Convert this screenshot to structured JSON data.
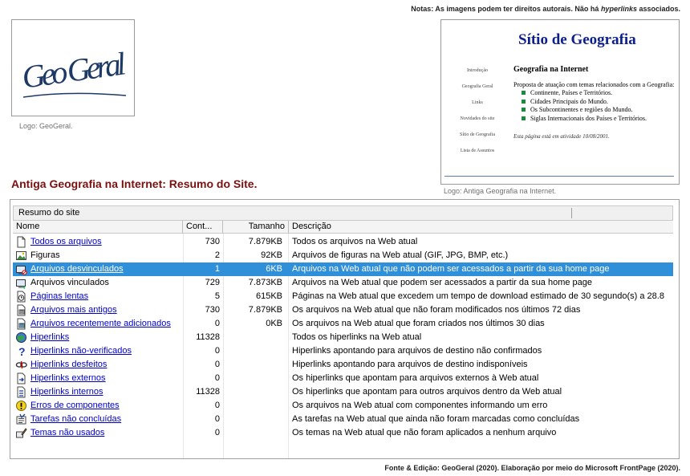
{
  "note": {
    "prefix": "Notas: As imagens podem ter direitos autorais. Não há ",
    "emphasis": "hyperlinks",
    "suffix": " associados."
  },
  "logo": {
    "text": "Geo Geral",
    "caption": "Logo: GeoGeral.",
    "color": "#1d3a66"
  },
  "screenshot": {
    "title": "Sítio de Geografia",
    "nav": [
      "Introdução",
      "Geografia Geral",
      "Links",
      "Novidades do site",
      "Sítio de Geografia",
      "Lista de Assuntos"
    ],
    "heading": "Geografia na Internet",
    "intro": "Proposta de atuação com temas relacionados com a Geografia:",
    "list": [
      "Continente, Países e Territórios.",
      "Cidades Principais do Mundo.",
      "Os Subcontinentes e regiões do Mundo.",
      "Siglas Internacionais dos Países e Territórios."
    ],
    "footer": "Esta página está em atividade 10/08/2001.",
    "caption": "Logo: Antiga Geografia na Internet."
  },
  "section_title": "Antiga Geografia na Internet: Resumo do Site.",
  "report": {
    "title": "Resumo do site",
    "columns": {
      "name": "Nome",
      "count": "Cont...",
      "size": "Tamanho",
      "desc": "Descrição"
    },
    "rows": [
      {
        "icon": "document-icon",
        "name": "Todos os arquivos",
        "count": "730",
        "size": "7.879KB",
        "desc": "Todos os arquivos na Web atual",
        "link": true,
        "selected": false
      },
      {
        "icon": "image-icon",
        "name": "Figuras",
        "count": "2",
        "size": "92KB",
        "desc": "Arquivos de figuras na Web atual (GIF, JPG, BMP, etc.)",
        "link": false,
        "selected": false
      },
      {
        "icon": "unlinked-files-icon",
        "name": "Arquivos desvinculados",
        "count": "1",
        "size": "6KB",
        "desc": "Arquivos na Web atual que não podem ser acessados a partir da sua home page",
        "link": true,
        "selected": true
      },
      {
        "icon": "linked-files-icon",
        "name": "Arquivos vinculados",
        "count": "729",
        "size": "7.873KB",
        "desc": "Arquivos na Web atual que podem ser acessados a partir da sua home page",
        "link": false,
        "selected": false
      },
      {
        "icon": "clock-icon",
        "name": "Páginas lentas",
        "count": "5",
        "size": "615KB",
        "desc": "Páginas na Web atual que excedem um tempo de download estimado de 30 segundo(s) a 28.8",
        "link": true,
        "selected": false
      },
      {
        "icon": "old-files-icon",
        "name": "Arquivos mais antigos",
        "count": "730",
        "size": "7.879KB",
        "desc": "Os arquivos na Web atual que não foram modificados nos últimos 72 dias",
        "link": true,
        "selected": false
      },
      {
        "icon": "new-files-icon",
        "name": "Arquivos recentemente  adicionados",
        "count": "0",
        "size": "0KB",
        "desc": "Os arquivos na Web atual que foram criados nos últimos 30 dias",
        "link": true,
        "selected": false
      },
      {
        "icon": "globe-icon",
        "name": "Hiperlinks",
        "count": "11328",
        "size": "",
        "desc": "Todos os hiperlinks na Web atual",
        "link": true,
        "selected": false
      },
      {
        "icon": "question-mark-icon",
        "name": "Hiperlinks não-verificados",
        "count": "0",
        "size": "",
        "desc": "Hiperlinks apontando para arquivos de destino não confirmados",
        "link": true,
        "selected": false
      },
      {
        "icon": "broken-link-icon",
        "name": "Hiperlinks desfeitos",
        "count": "0",
        "size": "",
        "desc": "Hiperlinks apontando para arquivos de destino indisponíveis",
        "link": true,
        "selected": false
      },
      {
        "icon": "external-link-icon",
        "name": "Hiperlinks externos",
        "count": "0",
        "size": "",
        "desc": "Os hiperlinks que apontam para arquivos externos à Web atual",
        "link": true,
        "selected": false
      },
      {
        "icon": "internal-link-icon",
        "name": "Hiperlinks internos",
        "count": "11328",
        "size": "",
        "desc": "Os hiperlinks que apontam para outros arquivos dentro da Web atual",
        "link": true,
        "selected": false
      },
      {
        "icon": "warning-icon",
        "name": "Erros de componentes",
        "count": "0",
        "size": "",
        "desc": "Os arquivos na Web atual com componentes informando um erro",
        "link": true,
        "selected": false
      },
      {
        "icon": "tasks-icon",
        "name": "Tarefas não concluídas",
        "count": "0",
        "size": "",
        "desc": "As tarefas na Web atual que ainda não foram marcadas como concluídas",
        "link": true,
        "selected": false
      },
      {
        "icon": "theme-brush-icon",
        "name": "Temas não usados",
        "count": "0",
        "size": "",
        "desc": "Os temas na Web atual que não foram aplicados a nenhum arquivo",
        "link": true,
        "selected": false
      }
    ]
  },
  "credit": "Fonte & Edição: GeoGeral (2020). Elaboração por meio do Microsoft FrontPage (2020).",
  "colors": {
    "selection": "#2f8fd8",
    "link": "#0000cc",
    "section_title": "#7a1010",
    "screenshot_title": "#0c1f8c"
  }
}
